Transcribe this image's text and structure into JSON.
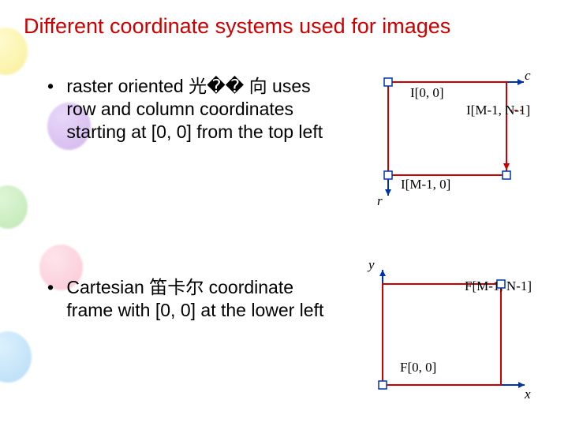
{
  "title": "Different coordinate systems used for images",
  "bullets": {
    "raster": "raster oriented 光�� 向 uses row and column coordinates starting at [0, 0] from the top left",
    "cartesian": "Cartesian 笛卡尔 coordinate frame with [0, 0] at the lower left"
  },
  "diagram_raster": {
    "axis_col": "c",
    "axis_row": "r",
    "tl": "I[0, 0]",
    "tr": "I[M-1, N-1]",
    "bl": "I[M-1, 0]"
  },
  "diagram_cartesian": {
    "axis_y": "y",
    "axis_x": "x",
    "tr": "F[M-1, N-1]",
    "bl": "F[0, 0]"
  }
}
